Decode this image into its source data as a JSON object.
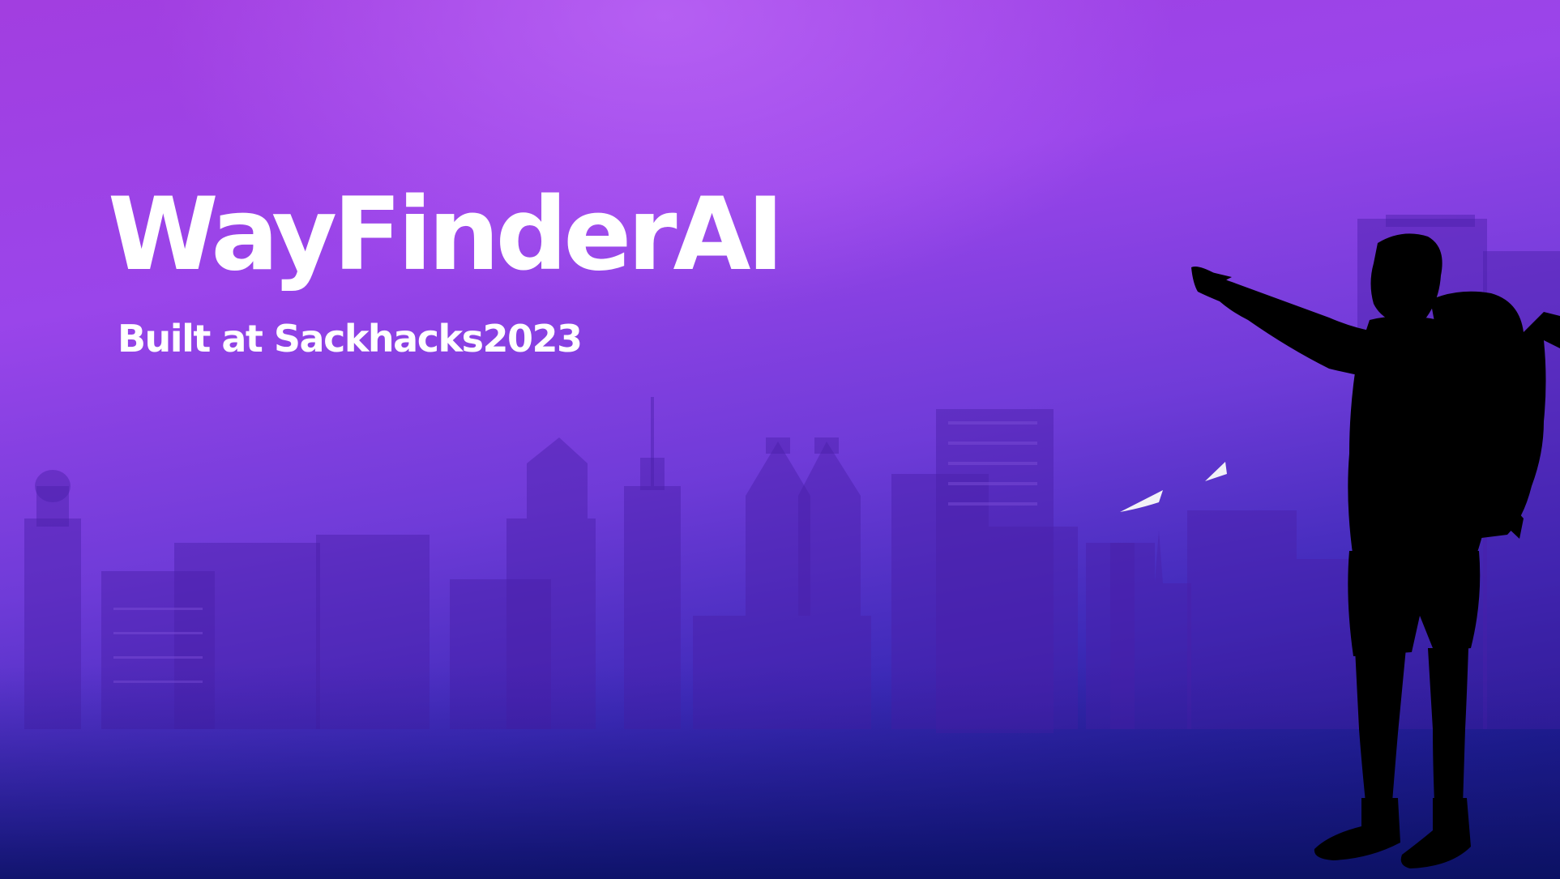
{
  "banner": {
    "title": "WayFinderAI",
    "subtitle": "Built at Sackhacks2023"
  },
  "illustrations": {
    "background": "city-skyline-silhouette",
    "figure": "hiker-pointing-silhouette",
    "accents": "paper-planes-icon"
  },
  "colors": {
    "gradient_top": "#a23ee0",
    "gradient_mid": "#6f3bd8",
    "gradient_bottom": "#0b1163",
    "text": "#ffffff",
    "silhouette": "#000000"
  }
}
